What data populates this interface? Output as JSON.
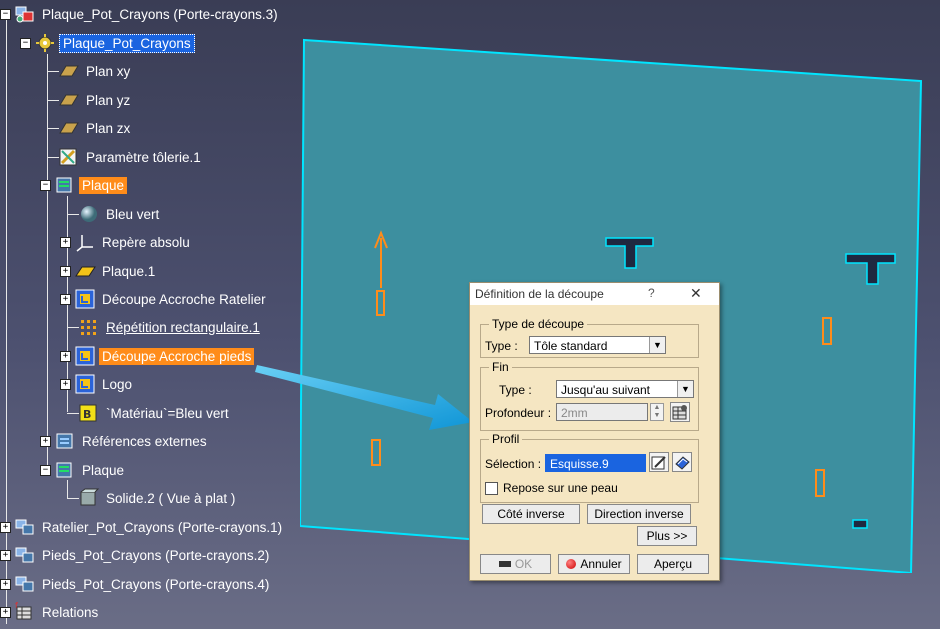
{
  "tree": {
    "root": "Plaque_Pot_Crayons (Porte-crayons.3)",
    "part": "Plaque_Pot_Crayons",
    "items": [
      {
        "label": "Plan xy"
      },
      {
        "label": "Plan yz"
      },
      {
        "label": "Plan zx"
      },
      {
        "label": "Paramètre tôlerie.1"
      },
      {
        "label": "Plaque"
      },
      {
        "label": "Bleu vert"
      },
      {
        "label": "Repère absolu"
      },
      {
        "label": "Plaque.1"
      },
      {
        "label": "Découpe Accroche Ratelier"
      },
      {
        "label": "Répétition rectangulaire.1"
      },
      {
        "label": "Découpe Accroche pieds"
      },
      {
        "label": "Logo"
      },
      {
        "label": "`Matériau`=Bleu vert"
      },
      {
        "label": "Références externes"
      },
      {
        "label": "Plaque"
      },
      {
        "label": "Solide.2 ( Vue à plat )"
      }
    ],
    "siblings": [
      {
        "label": "Ratelier_Pot_Crayons (Porte-crayons.1)"
      },
      {
        "label": "Pieds_Pot_Crayons (Porte-crayons.2)"
      },
      {
        "label": "Pieds_Pot_Crayons (Porte-crayons.4)"
      },
      {
        "label": "Relations"
      }
    ]
  },
  "dialog": {
    "title": "Définition de la découpe",
    "help": "?",
    "close": "✕",
    "type_group": {
      "title": "Type de découpe",
      "type_label": "Type :",
      "type_value": "Tôle standard"
    },
    "end_group": {
      "title": "Fin",
      "type_label": "Type :",
      "type_value": "Jusqu'au suivant",
      "depth_label": "Profondeur :",
      "depth_value": "2mm"
    },
    "profile_group": {
      "title": "Profil",
      "selection_label": "Sélection :",
      "selection_value": "Esquisse.9",
      "checkbox_label": "Repose sur une peau"
    },
    "buttons": {
      "reverse_side": "Côté inverse",
      "reverse_direction": "Direction inverse",
      "more": "Plus >>",
      "ok": "OK",
      "cancel": "Annuler",
      "preview": "Aperçu"
    }
  },
  "colors": {
    "selected": "#ff8c1a",
    "highlight": "#1a64e0",
    "part_fill": "#3d8f9f",
    "part_edge": "#00e5ff",
    "arrow": "#19a8e6"
  }
}
